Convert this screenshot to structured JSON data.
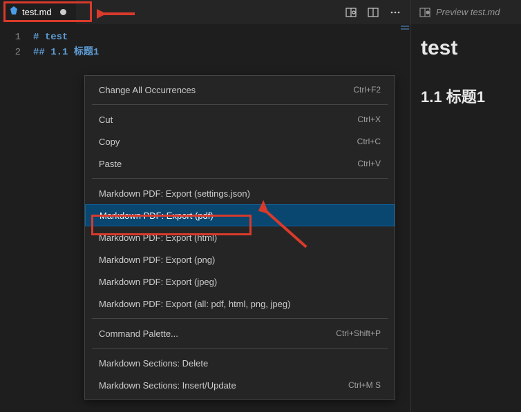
{
  "tab": {
    "filename": "test.md",
    "modified": true
  },
  "editor": {
    "lines": [
      {
        "num": "1",
        "prefix": "# ",
        "text": "test"
      },
      {
        "num": "2",
        "prefix": "## ",
        "text": "1.1 标题1"
      }
    ]
  },
  "contextMenu": {
    "groups": [
      [
        {
          "label": "Change All Occurrences",
          "shortcut": "Ctrl+F2"
        }
      ],
      [
        {
          "label": "Cut",
          "shortcut": "Ctrl+X"
        },
        {
          "label": "Copy",
          "shortcut": "Ctrl+C"
        },
        {
          "label": "Paste",
          "shortcut": "Ctrl+V"
        }
      ],
      [
        {
          "label": "Markdown PDF: Export (settings.json)",
          "shortcut": ""
        },
        {
          "label": "Markdown PDF: Export (pdf)",
          "shortcut": "",
          "highlighted": true
        },
        {
          "label": "Markdown PDF: Export (html)",
          "shortcut": ""
        },
        {
          "label": "Markdown PDF: Export (png)",
          "shortcut": ""
        },
        {
          "label": "Markdown PDF: Export (jpeg)",
          "shortcut": ""
        },
        {
          "label": "Markdown PDF: Export (all: pdf, html, png, jpeg)",
          "shortcut": ""
        }
      ],
      [
        {
          "label": "Command Palette...",
          "shortcut": "Ctrl+Shift+P"
        }
      ],
      [
        {
          "label": "Markdown Sections: Delete",
          "shortcut": ""
        },
        {
          "label": "Markdown Sections: Insert/Update",
          "shortcut": "Ctrl+M S"
        }
      ]
    ]
  },
  "preview": {
    "tabLabel": "Preview test.md",
    "h1": "test",
    "h2": "1.1 标题1"
  }
}
